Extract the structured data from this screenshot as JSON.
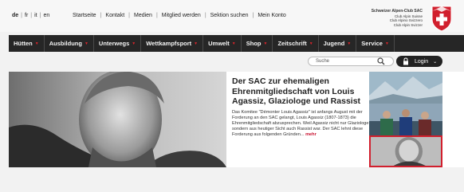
{
  "languages": [
    {
      "code": "de",
      "active": true
    },
    {
      "code": "fr",
      "active": false
    },
    {
      "code": "it",
      "active": false
    },
    {
      "code": "en",
      "active": false
    }
  ],
  "utility_links": [
    "Startseite",
    "Kontakt",
    "Medien",
    "Mitglied werden",
    "Sektion suchen",
    "Mein Konto"
  ],
  "brand": {
    "title": "Schweizer Alpen-Club SAC",
    "line2": "Club Alpin Suisse",
    "line3": "Club Alpino Svizzero",
    "line4": "Club Alpin Svizzer"
  },
  "nav": [
    "Hütten",
    "Ausbildung",
    "Unterwegs",
    "Wettkampfsport",
    "Umwelt",
    "Shop",
    "Zeitschrift",
    "Jugend",
    "Service"
  ],
  "search": {
    "placeholder": "Suche"
  },
  "login": {
    "label": "Login"
  },
  "article": {
    "title": "Der SAC zur ehemaligen Ehrenmitgliedschaft von Louis Agassiz, Glaziologe und Rassist",
    "body": "Das Komitee \"Démonter Louis Agassiz\" ist anfangs August mit der Forderung an den SAC gelangt, Louis Agassiz (1807-1873) die Ehrenmitgliedschaft abzusprechen. Weil Agassiz nicht nur Glaziologe, sondern aus heutiger Sicht auch Rassist war. Der SAC lehnt diese Forderung aus folgenden Gründen...",
    "more": "mehr"
  },
  "colors": {
    "accent": "#d11f2d",
    "nav_bg": "#262626"
  },
  "icons": [
    "swiss-cross-logo",
    "search-icon",
    "lock-icon",
    "chevron-down-icon"
  ]
}
